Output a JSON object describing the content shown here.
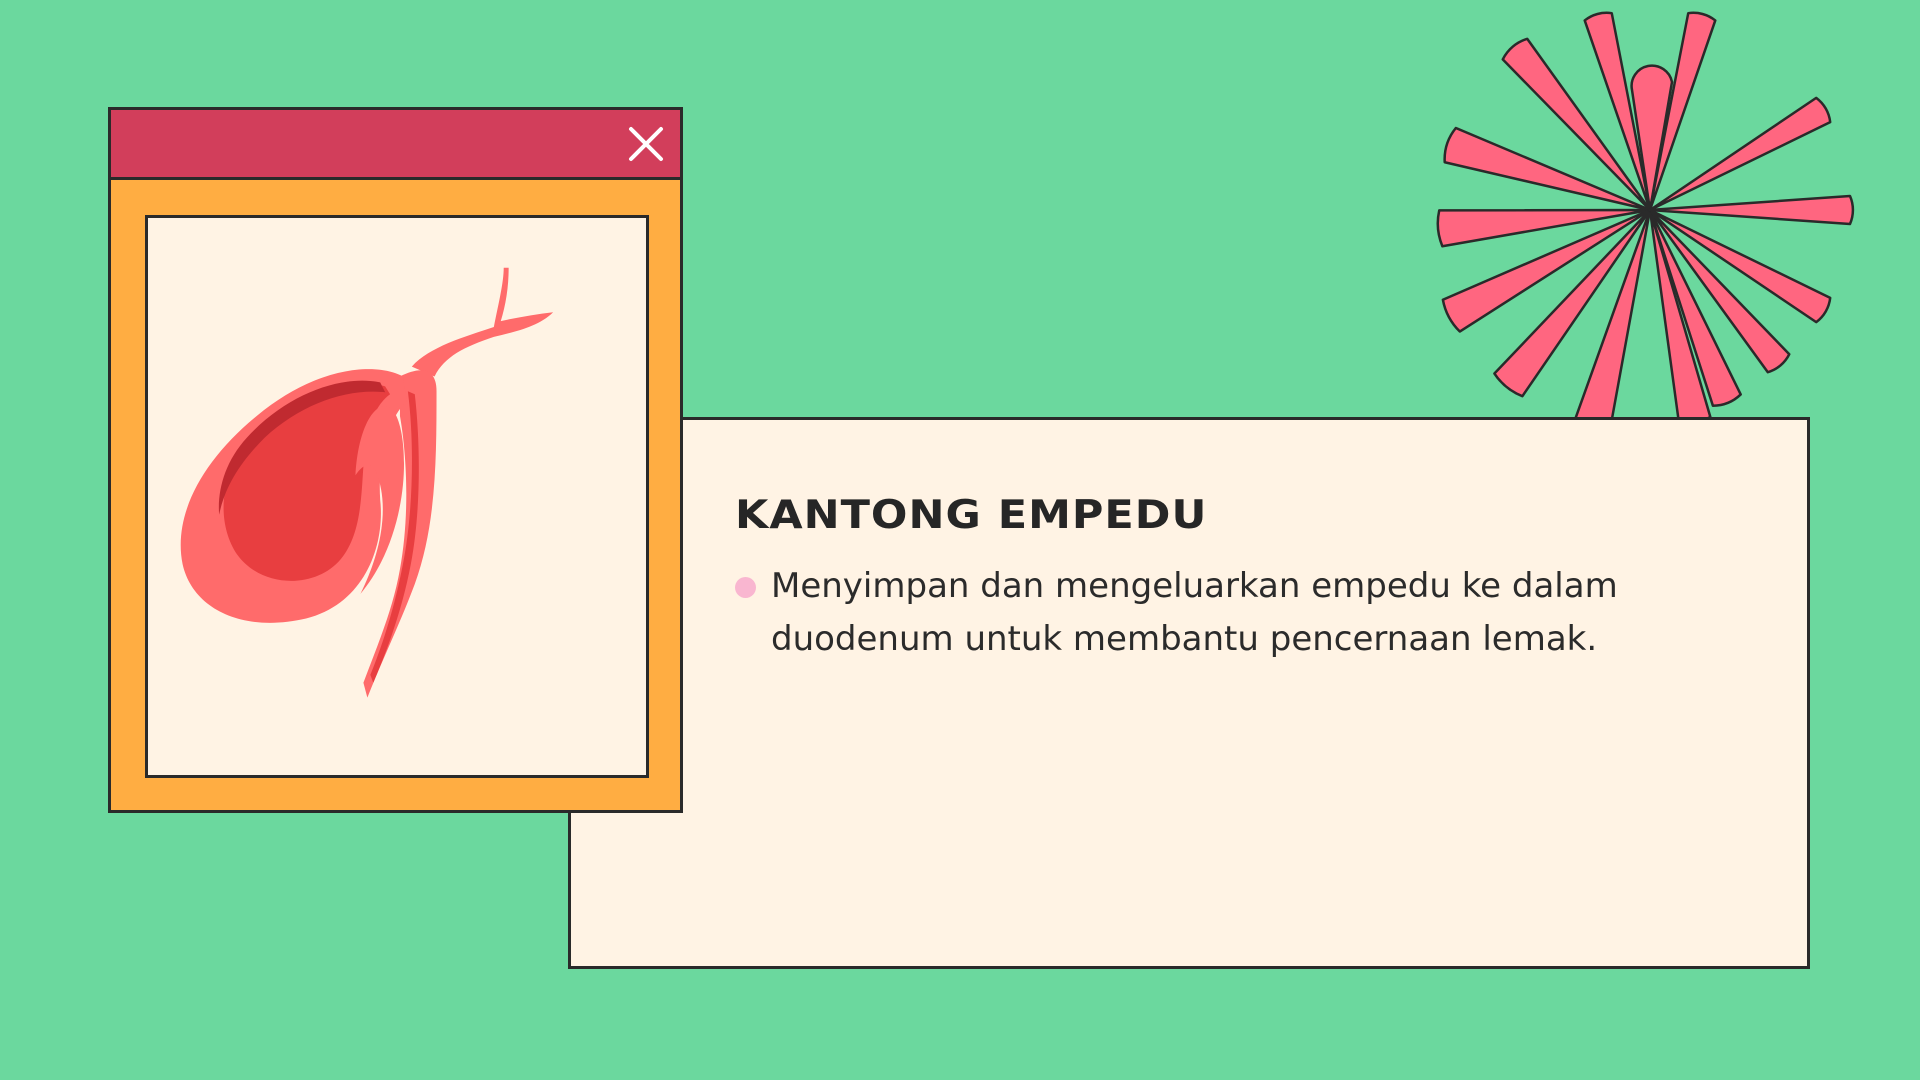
{
  "slide": {
    "title": "KANTONG EMPEDU",
    "bullets": [
      "Menyimpan dan mengeluarkan empedu ke dalam duodenum untuk membantu pencernaan lemak."
    ]
  },
  "window": {
    "close_icon": "close-icon",
    "image_icon": "gallbladder-illustration"
  },
  "colors": {
    "background": "#6bd89e",
    "flower": "#ff6680",
    "titlebar": "#d23e5b",
    "window_frame": "#ffad42",
    "panel": "#fff3e4",
    "bullet": "#f9b6d0",
    "organ_light": "#ff6b6b",
    "organ_dark": "#e83e40"
  }
}
